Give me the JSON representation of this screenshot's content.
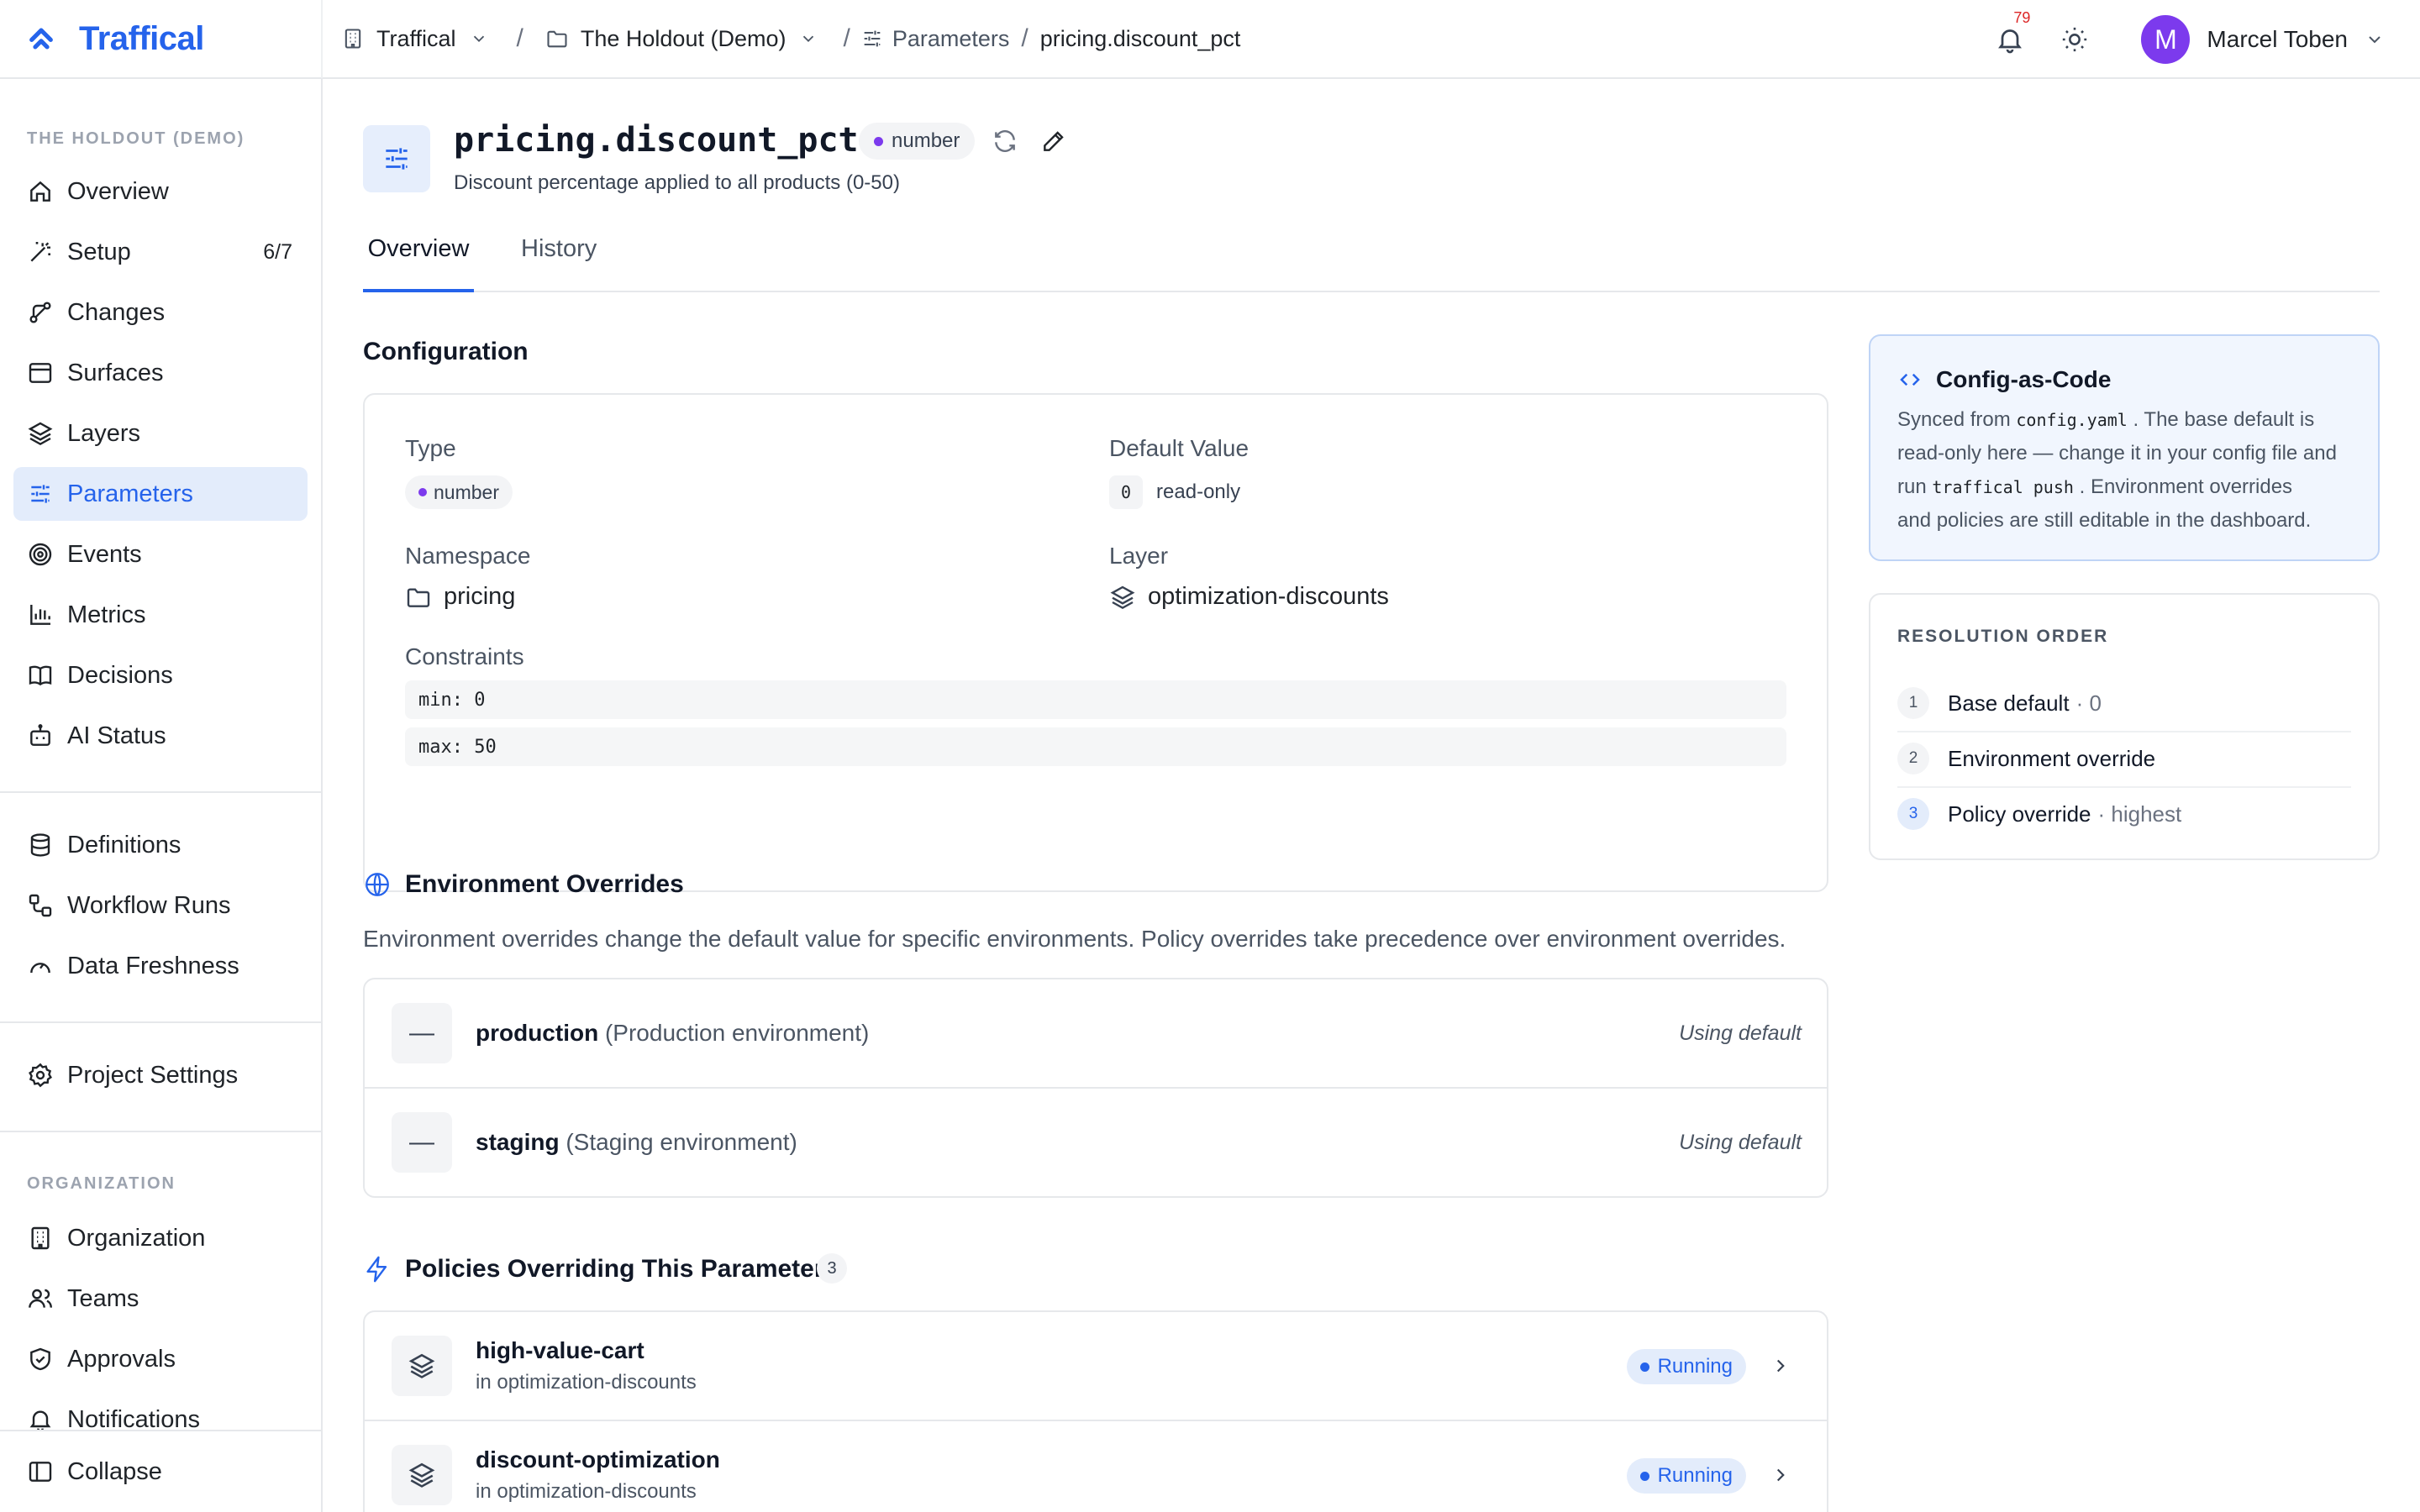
{
  "header": {
    "brand": "Traffical",
    "breadcrumbs": {
      "org": "Traffical",
      "project": "The Holdout (Demo)",
      "section": "Parameters",
      "current": "pricing.discount_pct"
    },
    "notifications_count": "79",
    "user": {
      "initial": "M",
      "name": "Marcel Toben"
    }
  },
  "sidebar": {
    "project_label": "THE HOLDOUT (DEMO)",
    "items": [
      {
        "label": "Overview",
        "icon": "home-icon"
      },
      {
        "label": "Setup",
        "icon": "wand-icon",
        "count": "6/7"
      },
      {
        "label": "Changes",
        "icon": "changes-icon"
      },
      {
        "label": "Surfaces",
        "icon": "window-icon"
      },
      {
        "label": "Layers",
        "icon": "layers-icon"
      },
      {
        "label": "Parameters",
        "icon": "sliders-icon",
        "active": true
      },
      {
        "label": "Events",
        "icon": "target-icon"
      },
      {
        "label": "Metrics",
        "icon": "bar-chart-icon"
      },
      {
        "label": "Decisions",
        "icon": "book-icon"
      },
      {
        "label": "AI Status",
        "icon": "bot-icon"
      }
    ],
    "items2": [
      {
        "label": "Definitions",
        "icon": "database-icon"
      },
      {
        "label": "Workflow Runs",
        "icon": "workflow-icon"
      },
      {
        "label": "Data Freshness",
        "icon": "gauge-icon"
      }
    ],
    "settings": {
      "label": "Project Settings",
      "icon": "gear-icon"
    },
    "org_label": "ORGANIZATION",
    "org_items": [
      {
        "label": "Organization",
        "icon": "building-icon"
      },
      {
        "label": "Teams",
        "icon": "users-icon"
      },
      {
        "label": "Approvals",
        "icon": "shield-check-icon"
      },
      {
        "label": "Notifications",
        "icon": "bell-icon"
      }
    ],
    "collapse": "Collapse"
  },
  "parameter": {
    "key": "pricing.discount_pct",
    "type": "number",
    "description": "Discount percentage applied to all products (0-50)"
  },
  "tabs": [
    "Overview",
    "History"
  ],
  "configuration": {
    "title": "Configuration",
    "type_label": "Type",
    "type_value": "number",
    "default_label": "Default Value",
    "default_value": "0",
    "default_note": "read-only",
    "namespace_label": "Namespace",
    "namespace_value": "pricing",
    "layer_label": "Layer",
    "layer_value": "optimization-discounts",
    "constraints_label": "Constraints",
    "constraints": [
      "min: 0",
      "max: 50"
    ]
  },
  "env_overrides": {
    "title": "Environment Overrides",
    "description": "Environment overrides change the default value for specific environments. Policy overrides take precedence over environment overrides.",
    "rows": [
      {
        "name": "production",
        "desc": "(Production environment)",
        "value": "—",
        "status": "Using default"
      },
      {
        "name": "staging",
        "desc": "(Staging environment)",
        "value": "—",
        "status": "Using default"
      }
    ]
  },
  "policies": {
    "title": "Policies Overriding This Parameter",
    "count": "3",
    "rows": [
      {
        "name": "high-value-cart",
        "layer": "in optimization-discounts",
        "status": "Running"
      },
      {
        "name": "discount-optimization",
        "layer": "in optimization-discounts",
        "status": "Running"
      }
    ]
  },
  "config_as_code": {
    "title": "Config-as-Code",
    "t1": "Synced from",
    "file": "config.yaml",
    "t2": ". The base default is",
    "t3": "read-only here — change it in your config file and",
    "t4": "run",
    "cmd": "traffical push",
    "t5": ". Environment overrides",
    "t6": "and policies are still editable in the dashboard."
  },
  "resolution": {
    "title": "RESOLUTION ORDER",
    "rows": [
      {
        "num": "1",
        "label": "Base default",
        "extra": "· 0"
      },
      {
        "num": "2",
        "label": "Environment override",
        "extra": ""
      },
      {
        "num": "3",
        "label": "Policy override",
        "extra": "· highest"
      }
    ]
  },
  "colors": {
    "accent": "#2563eb",
    "active_bg": "#e3ecfb",
    "type_dot": "#7c3aed",
    "running_dot": "#2563eb"
  }
}
